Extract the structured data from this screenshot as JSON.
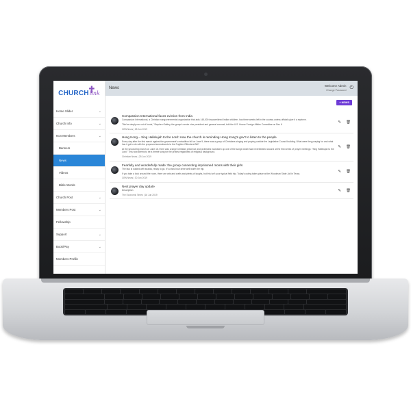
{
  "app": {
    "logo_main": "CHURCH",
    "logo_script": "link",
    "page_title": "News",
    "welcome": "Welcome Admin",
    "change_password": "Change Password"
  },
  "sidebar": {
    "items": [
      {
        "label": "Home Slider",
        "chevron": true,
        "sub": false,
        "active": false
      },
      {
        "label": "Church Info",
        "chevron": true,
        "sub": false,
        "active": false
      },
      {
        "label": "Non Members",
        "chevron": true,
        "sub": false,
        "active": false
      },
      {
        "label": "Banners",
        "chevron": false,
        "sub": true,
        "active": false
      },
      {
        "label": "News",
        "chevron": false,
        "sub": true,
        "active": true
      },
      {
        "label": "Videos",
        "chevron": false,
        "sub": true,
        "active": false
      },
      {
        "label": "Bible Words",
        "chevron": false,
        "sub": true,
        "active": false
      },
      {
        "label": "Church Post",
        "chevron": true,
        "sub": false,
        "active": false
      },
      {
        "label": "Members Post",
        "chevron": true,
        "sub": false,
        "active": false
      },
      {
        "label": "Fellowship",
        "chevron": false,
        "sub": false,
        "active": false
      },
      {
        "label": "Support",
        "chevron": true,
        "sub": false,
        "active": false
      },
      {
        "label": "Book/Pay",
        "chevron": true,
        "sub": false,
        "active": false
      },
      {
        "label": "Members Profile",
        "chevron": false,
        "sub": false,
        "active": false
      }
    ]
  },
  "toolbar": {
    "add_news_label": "+ NEWS"
  },
  "news": [
    {
      "title": "Compassion International faces eviction from India",
      "paragraphs": [
        "Compassion International, a Christian nongovernmental organization that aids 145,000 impoverished Indian children, has three weeks left in the country unless officials give it a reprieve.",
        "\"We've simply run out of funds,\" Stephen Oakley, the group's senior vice president and general counsel, told the U.S. House Foreign Affairs Committee on Dec 6"
      ],
      "meta": "CBN News | 28 Jun 2019"
    },
    {
      "title": "Hong Kong – Sing Hallelujah to the Lord: How the church is reminding Hong Kong's gov't to listen to the people",
      "paragraphs": [
        "Every day after the first march against the government's extradition bill on June 9, there was a group of Christians singing and praying outside the Legislative Council building. What were they praying for and what has it got to do with the proposed amendments to the Fugitive Offenders Bill?",
        "At the second big march on June 16, there was a large Christian presence and protesters had taken up one of the songs which had reverberated around at the first series of prayer meetings: \"Sing Hallelujah to the Lord.\" This now seems to be a theme song for the protest regardless of religious background."
      ],
      "meta": "Christian News | 25 Jun 2019"
    },
    {
      "title": "Fearfully and wonderfully made: the group connecting imprisoned moms with their girls",
      "paragraphs": [
        "The bus is loaded with snacks, ready to go. It's a two-hour drive well worth the trip.",
        "If you take a look around the room, there are arts and crafts and plenty of laughs, but this isn't your typical field trip. Today's outing takes place at the Woodman State Jail in Texas."
      ],
      "meta": "CBN News | 30 Jun 2019"
    },
    {
      "title": "Next prayer day update",
      "paragraphs": [
        "Description"
      ],
      "meta": "The Economic Times | 16 Jun 2019"
    }
  ],
  "colors": {
    "accent": "#2a86d8",
    "button": "#6e3bd6",
    "topbar": "#d9dfe5",
    "logo_blue": "#2566c7",
    "logo_purple": "#8d55c2"
  },
  "icons": {
    "power": "power-icon",
    "edit": "pencil-icon",
    "delete": "trash-icon",
    "chevron": "chevron-down-icon"
  }
}
